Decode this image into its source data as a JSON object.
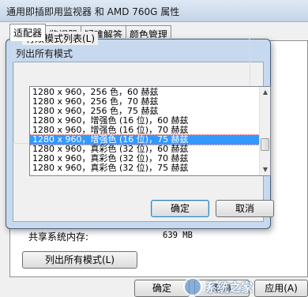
{
  "window": {
    "title": "通用即插即用监视器 和 AMD 760G 属性"
  },
  "tabs": [
    "适配器",
    "监视器",
    "疑难解答",
    "颜色管理"
  ],
  "panel": {
    "shared_memory_label": "共享系统内存:",
    "shared_memory_value": "639 MB",
    "list_all_modes_button": "列出所有模式(L)"
  },
  "bottom_buttons": {
    "ok": "确定",
    "cancel": "取消",
    "apply": "应用(A)"
  },
  "watermark": "系统之家",
  "dialog": {
    "title": "列出所有模式",
    "group_label": "有效模式列表(L)",
    "modes": [
      "1280 x 960，256 色，60 赫兹",
      "1280 x 960，256 色，70 赫兹",
      "1280 x 960，256 色，75 赫兹",
      "1280 x 960，增强色 (16 位)，60 赫兹",
      "1280 x 960，增强色 (16 位)，70 赫兹",
      "1280 x 960，增强色 (16 位)，75 赫兹",
      "1280 x 960，真彩色 (32 位)，60 赫兹",
      "1280 x 960，真彩色 (32 位)，70 赫兹",
      "1280 x 960，真彩色 (32 位)，75 赫兹"
    ],
    "selected_index": 5,
    "ok_button": "确定",
    "cancel_button": "取消"
  }
}
